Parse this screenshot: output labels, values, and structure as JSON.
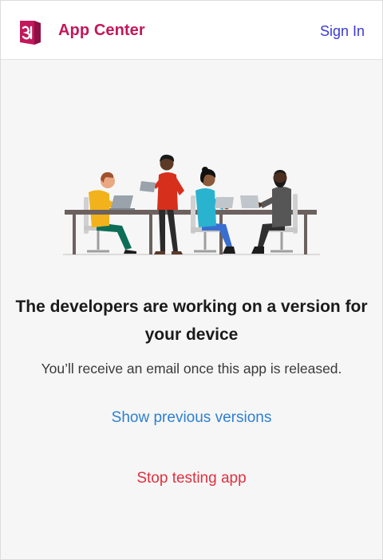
{
  "header": {
    "brand": "App Center",
    "sign_in_label": "Sign In",
    "logo_icon": "app-center-logo-icon"
  },
  "main": {
    "illustration": "developers-working-illustration",
    "headline": "The developers are working on a version for your device",
    "message": "You’ll receive an email once this app is released.",
    "show_previous_label": "Show previous versions",
    "stop_testing_label": "Stop testing app"
  },
  "colors": {
    "brand": "#c2185b",
    "link": "#2d7fd3",
    "danger": "#e0303f",
    "sign_in": "#3b3bd6"
  }
}
